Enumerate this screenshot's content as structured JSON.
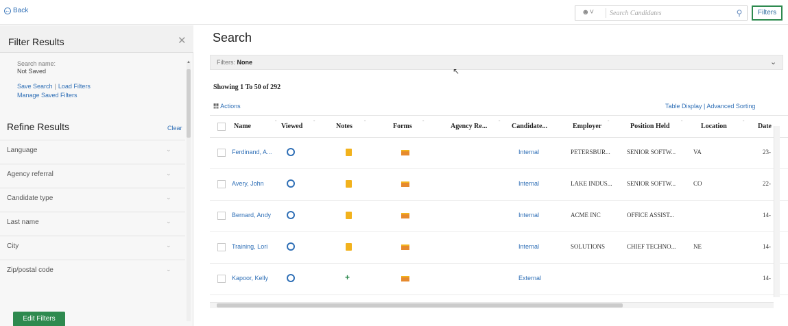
{
  "topbar": {
    "back_label": "Back",
    "search_placeholder": "Search Candidates",
    "filters_button": "Filters"
  },
  "sidebar": {
    "title": "Filter Results",
    "search_name_label": "Search name:",
    "search_name_value": "Not Saved",
    "save_search": "Save Search",
    "load_filters": "Load Filters",
    "manage_saved_filters": "Manage Saved Filters",
    "refine_title": "Refine Results",
    "clear_label": "Clear",
    "facets": [
      "Language",
      "Agency referral",
      "Candidate type",
      "Last name",
      "City",
      "Zip/postal code"
    ],
    "edit_filters": "Edit Filters"
  },
  "main": {
    "title": "Search",
    "filters_label": "Filters:",
    "filters_value": "None",
    "showing_text": "Showing 1 To 50 of 292",
    "actions_label": "Actions",
    "table_display": "Table Display",
    "advanced_sorting": "Advanced Sorting"
  },
  "table": {
    "columns": [
      "Name",
      "Viewed",
      "Notes",
      "Forms",
      "Agency Re...",
      "Candidate...",
      "Employer",
      "Position Held",
      "Location",
      "Date"
    ],
    "rows": [
      {
        "name": "Ferdinand, A...",
        "notes": "note",
        "type": "Internal",
        "employer": "PETERSBUR...",
        "position": "SENIOR SOFTW...",
        "location": "VA",
        "date": "23-"
      },
      {
        "name": "Avery, John",
        "notes": "note",
        "type": "Internal",
        "employer": "LAKE INDUS...",
        "position": "SENIOR SOFTW...",
        "location": "CO",
        "date": "22-"
      },
      {
        "name": "Bernard, Andy",
        "notes": "note",
        "type": "Internal",
        "employer": "ACME INC",
        "position": "OFFICE ASSIST...",
        "location": "",
        "date": "14-"
      },
      {
        "name": "Training, Lori",
        "notes": "note",
        "type": "Internal",
        "employer": "SOLUTIONS",
        "position": "CHIEF TECHNO...",
        "location": "NE",
        "date": "14-"
      },
      {
        "name": "Kapoor, Kelly",
        "notes": "plus",
        "type": "External",
        "employer": "",
        "position": "",
        "location": "",
        "date": "14-"
      }
    ]
  },
  "colors": {
    "accent_green": "#2e8a4f",
    "link_blue": "#2f6fb6",
    "note_yellow": "#f2b21d",
    "form_orange": "#e68a2e"
  }
}
